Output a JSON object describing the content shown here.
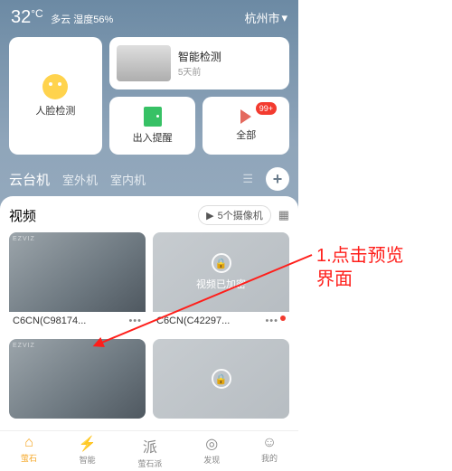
{
  "status": {
    "temp": "32",
    "unit": "°C",
    "weather": "多云 湿度56%",
    "city": "杭州市"
  },
  "feature_cards": {
    "face": "人脸检测",
    "detect_title": "智能检测",
    "detect_sub": "5天前",
    "door": "出入提醒",
    "all": "全部",
    "all_badge": "99+"
  },
  "tabs": {
    "t1": "云台机",
    "t2": "室外机",
    "t3": "室内机"
  },
  "video": {
    "title": "视频",
    "count": "5个摄像机",
    "encrypted_text": "视频已加密",
    "cam1": "C6CN(C98174...",
    "cam2": "C6CN(C42297...",
    "more": "•••"
  },
  "bottom": {
    "b1": "萤石",
    "b2": "智能",
    "b3": "萤石派",
    "b4": "发现",
    "b5": "我的"
  },
  "annotation": {
    "line1": "1.点击预览",
    "line2": "界面"
  }
}
